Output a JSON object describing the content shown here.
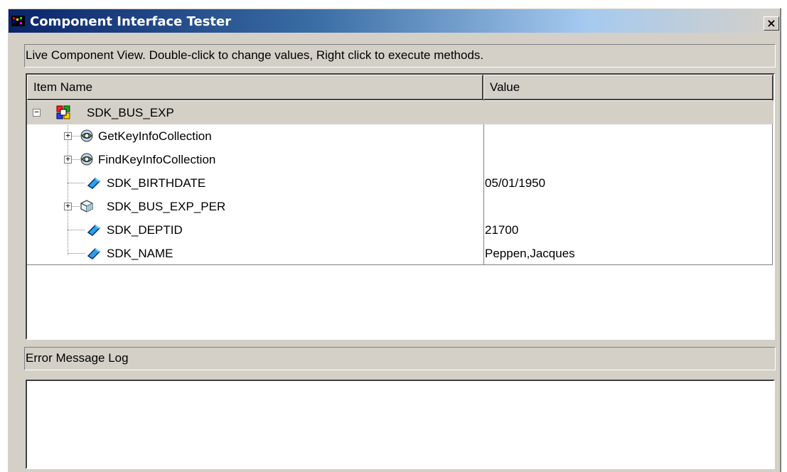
{
  "window": {
    "title": "Component Interface Tester",
    "close_label": "×"
  },
  "hint": "Live Component View.   Double-click to change values, Right click to execute methods.",
  "tree": {
    "columns": [
      "Item Name",
      "Value"
    ],
    "rows": [
      {
        "name": "SDK_BUS_EXP",
        "value": "",
        "icon": "component-icon",
        "expander": "−"
      },
      {
        "name": "GetKeyInfoCollection",
        "value": "",
        "icon": "collection-icon",
        "expander": "+"
      },
      {
        "name": "FindKeyInfoCollection",
        "value": "",
        "icon": "collection-icon",
        "expander": "+"
      },
      {
        "name": "SDK_BIRTHDATE",
        "value": "05/01/1950",
        "icon": "property-icon",
        "expander": ""
      },
      {
        "name": "SDK_BUS_EXP_PER",
        "value": "",
        "icon": "cube-icon",
        "expander": "+"
      },
      {
        "name": "SDK_DEPTID",
        "value": "21700",
        "icon": "property-icon",
        "expander": ""
      },
      {
        "name": "SDK_NAME",
        "value": "Peppen,Jacques",
        "icon": "property-icon",
        "expander": ""
      }
    ]
  },
  "error_log": {
    "label": "Error Message Log",
    "content": ""
  }
}
